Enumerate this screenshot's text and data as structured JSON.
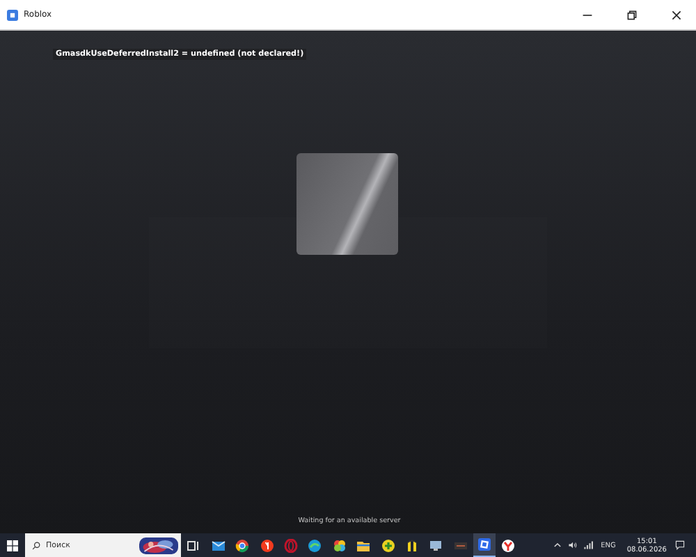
{
  "window": {
    "title": "Roblox"
  },
  "debug_message": "GmasdkUseDeferredInstall2 = undefined (not declared!)",
  "status": "Waiting for an available server",
  "taskbar": {
    "search": {
      "placeholder": "Поиск"
    },
    "apps": [
      {
        "kind": "taskview",
        "selected": false
      },
      {
        "kind": "mail",
        "selected": false
      },
      {
        "kind": "chrome",
        "selected": false
      },
      {
        "kind": "yandex",
        "selected": false
      },
      {
        "kind": "opera",
        "selected": false
      },
      {
        "kind": "edge",
        "selected": false
      },
      {
        "kind": "photos",
        "selected": false
      },
      {
        "kind": "folder",
        "selected": false
      },
      {
        "kind": "greenball",
        "selected": false
      },
      {
        "kind": "bars",
        "selected": false
      },
      {
        "kind": "computer",
        "selected": false
      },
      {
        "kind": "dark",
        "selected": false
      },
      {
        "kind": "roblox",
        "selected": true
      },
      {
        "kind": "ybrowser",
        "selected": false
      }
    ],
    "language": "ENG",
    "time": "15:01",
    "date": "08.06.2026"
  }
}
